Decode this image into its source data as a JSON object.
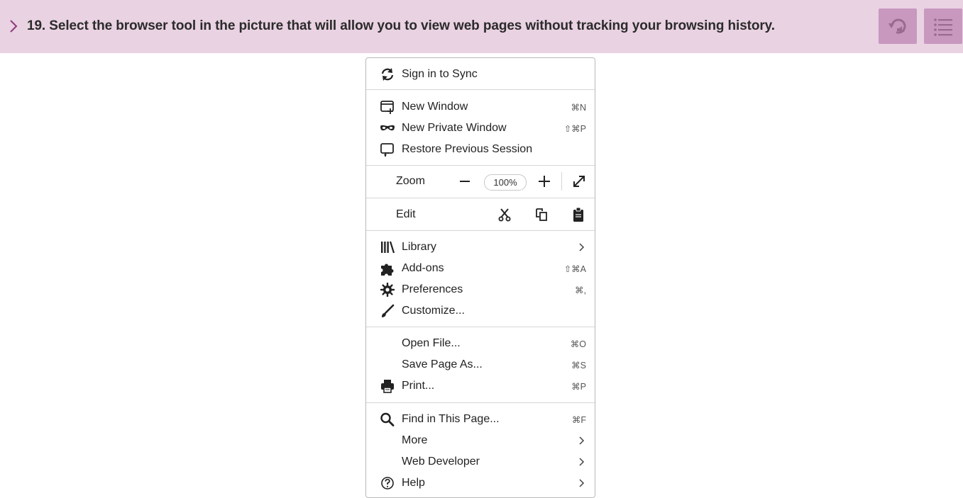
{
  "question": {
    "text": "19. Select the browser tool in the picture that will allow you to view web pages without tracking your browsing history."
  },
  "toolbar": {
    "replay_icon": "replay-audio-icon",
    "list_icon": "list-icon"
  },
  "colors": {
    "header_bg": "#e9d2e2",
    "button_bg": "#c898bf",
    "accent": "#8e3a7a"
  },
  "menu": {
    "sync": {
      "label": "Sign in to Sync",
      "icon": "sync-icon"
    },
    "new_window": {
      "label": "New Window",
      "shortcut": "⌘N",
      "icon": "new-window-icon"
    },
    "private_window": {
      "label": "New Private Window",
      "shortcut": "⇧⌘P",
      "icon": "private-mask-icon"
    },
    "restore": {
      "label": "Restore Previous Session",
      "icon": "restore-session-icon"
    },
    "zoom": {
      "label": "Zoom",
      "value": "100%"
    },
    "edit": {
      "label": "Edit"
    },
    "library": {
      "label": "Library",
      "icon": "library-icon"
    },
    "addons": {
      "label": "Add-ons",
      "shortcut": "⇧⌘A",
      "icon": "puzzle-icon"
    },
    "preferences": {
      "label": "Preferences",
      "shortcut": "⌘,",
      "icon": "gear-icon"
    },
    "customize": {
      "label": "Customize...",
      "icon": "brush-icon"
    },
    "open_file": {
      "label": "Open File...",
      "shortcut": "⌘O"
    },
    "save_page": {
      "label": "Save Page As...",
      "shortcut": "⌘S"
    },
    "print": {
      "label": "Print...",
      "shortcut": "⌘P",
      "icon": "printer-icon"
    },
    "find": {
      "label": "Find in This Page...",
      "shortcut": "⌘F",
      "icon": "search-icon"
    },
    "more": {
      "label": "More"
    },
    "web_developer": {
      "label": "Web Developer"
    },
    "help": {
      "label": "Help",
      "icon": "help-icon"
    }
  }
}
